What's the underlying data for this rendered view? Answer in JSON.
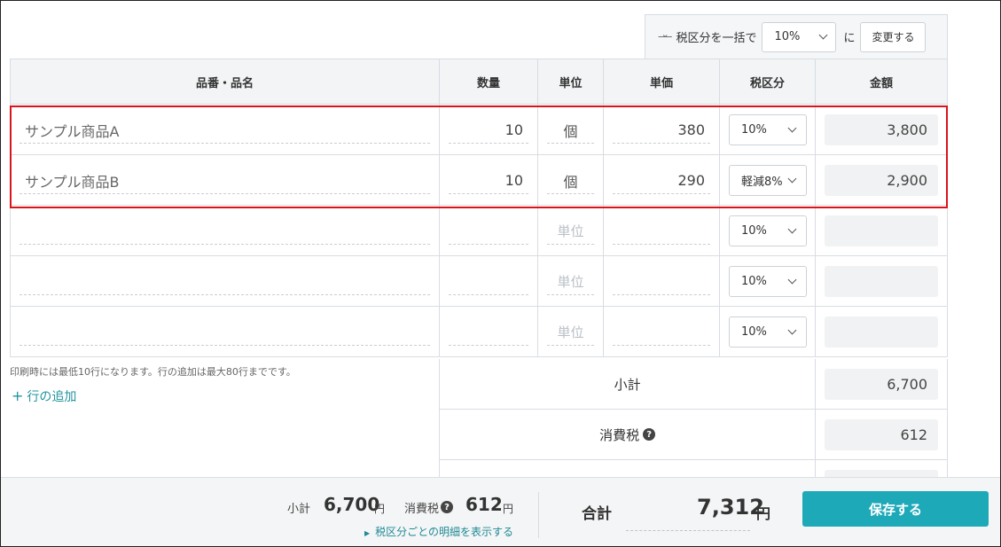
{
  "bulk_tax": {
    "icon": "swap-arrows-icon",
    "label": "税区分を一括で",
    "selected": "10%",
    "connector": "に",
    "button_label": "変更する"
  },
  "columns": [
    "品番・品名",
    "数量",
    "単位",
    "単価",
    "税区分",
    "金額"
  ],
  "rows": [
    {
      "name": "サンプル商品A",
      "quantity": "10",
      "unit": "個",
      "unit_placeholder": "",
      "price": "380",
      "tax": "10%",
      "amount": "3,800"
    },
    {
      "name": "サンプル商品B",
      "quantity": "10",
      "unit": "個",
      "unit_placeholder": "",
      "price": "290",
      "tax": "軽減8%",
      "amount": "2,900"
    },
    {
      "name": "",
      "quantity": "",
      "unit": "",
      "unit_placeholder": "単位",
      "price": "",
      "tax": "10%",
      "amount": ""
    },
    {
      "name": "",
      "quantity": "",
      "unit": "",
      "unit_placeholder": "単位",
      "price": "",
      "tax": "10%",
      "amount": ""
    },
    {
      "name": "",
      "quantity": "",
      "unit": "",
      "unit_placeholder": "単位",
      "price": "",
      "tax": "10%",
      "amount": ""
    }
  ],
  "note": "印刷時には最低10行になります。行の追加は最大80行までです。",
  "add_row": {
    "plus": "+",
    "label": "行の追加"
  },
  "summary": {
    "subtotal_label": "小計",
    "subtotal_value": "6,700",
    "tax_label": "消費税",
    "tax_help": "?",
    "tax_value": "612"
  },
  "footer": {
    "subtotal_label": "小計",
    "subtotal_value": "6,700",
    "subtotal_unit": "円",
    "tax_label": "消費税",
    "tax_help": "?",
    "tax_value": "612",
    "tax_unit": "円",
    "link_label": "税区分ごとの明細を表示する",
    "total_label": "合計",
    "total_value": "7,312",
    "total_unit": "円",
    "save_label": "保存する"
  },
  "colors": {
    "accent": "#1ea9b8",
    "highlight": "#d9151b",
    "link": "#21949e"
  }
}
